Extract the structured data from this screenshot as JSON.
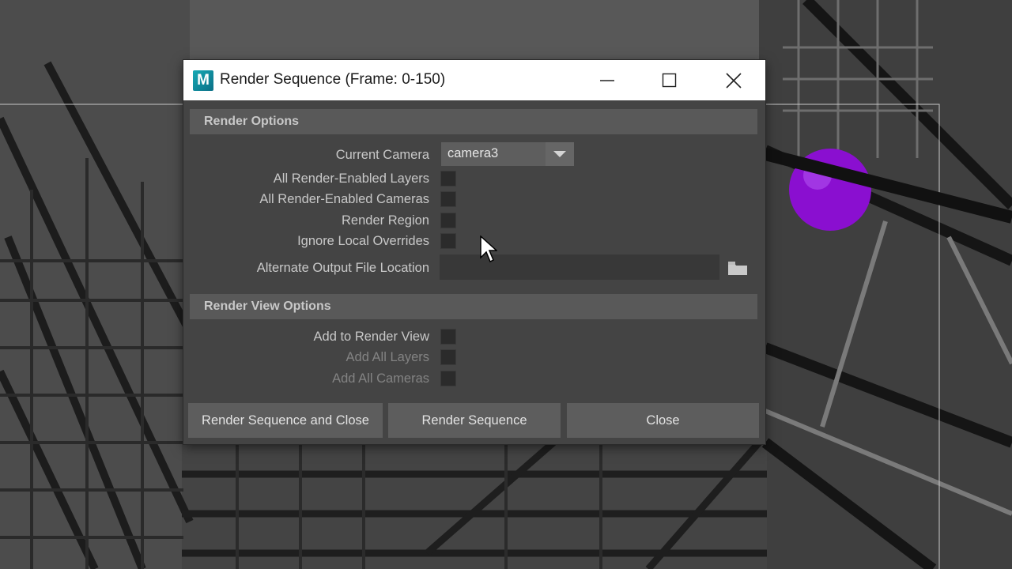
{
  "window": {
    "title": "Render Sequence (Frame: 0-150)",
    "logo_letter": "M"
  },
  "render_options": {
    "header": "Render Options",
    "current_camera_label": "Current Camera",
    "current_camera_value": "camera3",
    "all_layers_label": "All Render-Enabled Layers",
    "all_cameras_label": "All Render-Enabled Cameras",
    "render_region_label": "Render Region",
    "ignore_overrides_label": "Ignore Local Overrides",
    "output_location_label": "Alternate Output File Location",
    "output_location_value": ""
  },
  "render_view_options": {
    "header": "Render View Options",
    "add_to_view_label": "Add to Render View",
    "add_all_layers_label": "Add All Layers",
    "add_all_cameras_label": "Add All Cameras"
  },
  "buttons": {
    "render_and_close": "Render Sequence and Close",
    "render": "Render Sequence",
    "close": "Close"
  },
  "icons": {
    "logo": "maya-logo-icon",
    "minimize": "minimize-icon",
    "maximize": "maximize-icon",
    "close": "close-icon",
    "dropdown": "chevron-down-icon",
    "folder": "folder-icon",
    "cursor": "mouse-pointer-icon"
  },
  "colors": {
    "dialog_bg": "#444444",
    "header_bg": "#595959",
    "button_bg": "#5d5d5d",
    "sphere": "#8a0fd0"
  }
}
